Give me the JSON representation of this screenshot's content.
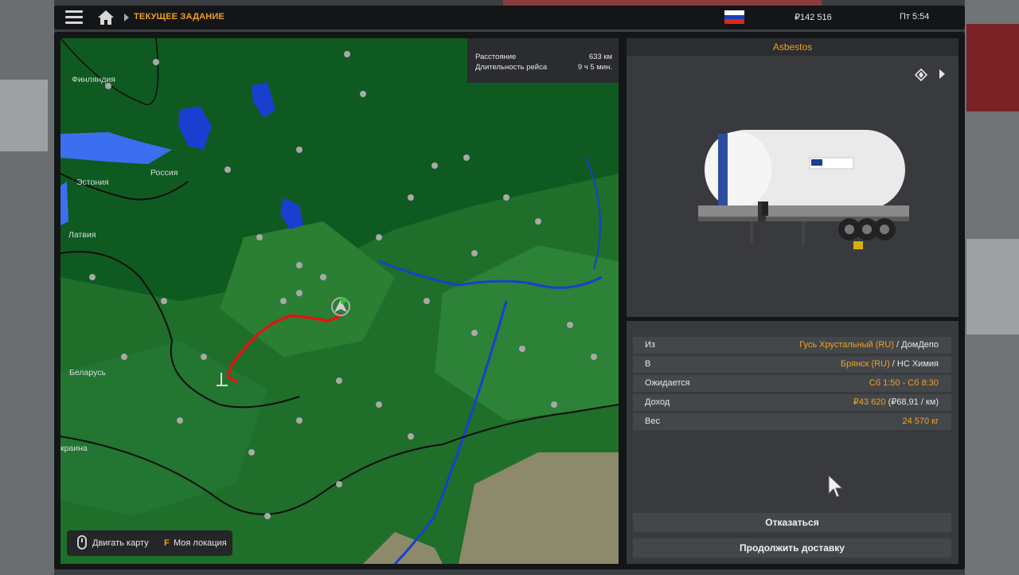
{
  "topbar": {
    "breadcrumb": "ТЕКУЩЕЕ ЗАДАНИЕ",
    "money": "₽142 516",
    "time": "Пт 5:54",
    "flag_colors": [
      "#ffffff",
      "#1c3fb8",
      "#d52b1e"
    ]
  },
  "route_info": {
    "distance_label": "Расстояние",
    "distance_value": "633 км",
    "duration_label": "Длительность рейса",
    "duration_value": "9 ч 5 мин."
  },
  "map": {
    "countries": {
      "finland": "Финляндия",
      "russia": "Россия",
      "estonia": "Эстония",
      "latvia": "Латвия",
      "belarus": "Беларусь",
      "ukraine": "краина"
    },
    "help": {
      "drag_label": "Двигать карту",
      "location_key": "F",
      "location_label": "Моя локация"
    },
    "colors": {
      "land": "#1f6e2a",
      "water": "#1a3fd0",
      "route": "#e01515"
    }
  },
  "cargo": {
    "name": "Asbestos",
    "trailer_icon": "silo-trailer-image"
  },
  "details": {
    "from_label": "Из",
    "from_city": "Гусь Хрустальный (RU)",
    "from_company": " / ДомДепо",
    "to_label": "В",
    "to_city": "Брянск (RU)",
    "to_company": " / НС Химия",
    "expected_label": "Ожидается",
    "expected_value": "Сб 1:50 - Сб 8:30",
    "income_label": "Доход",
    "income_value": "₽43 620",
    "income_per_km": " (₽68,91 / км)",
    "weight_label": "Вес",
    "weight_value": "24 570 кг"
  },
  "actions": {
    "decline": "Отказаться",
    "continue": "Продолжить доставку"
  }
}
